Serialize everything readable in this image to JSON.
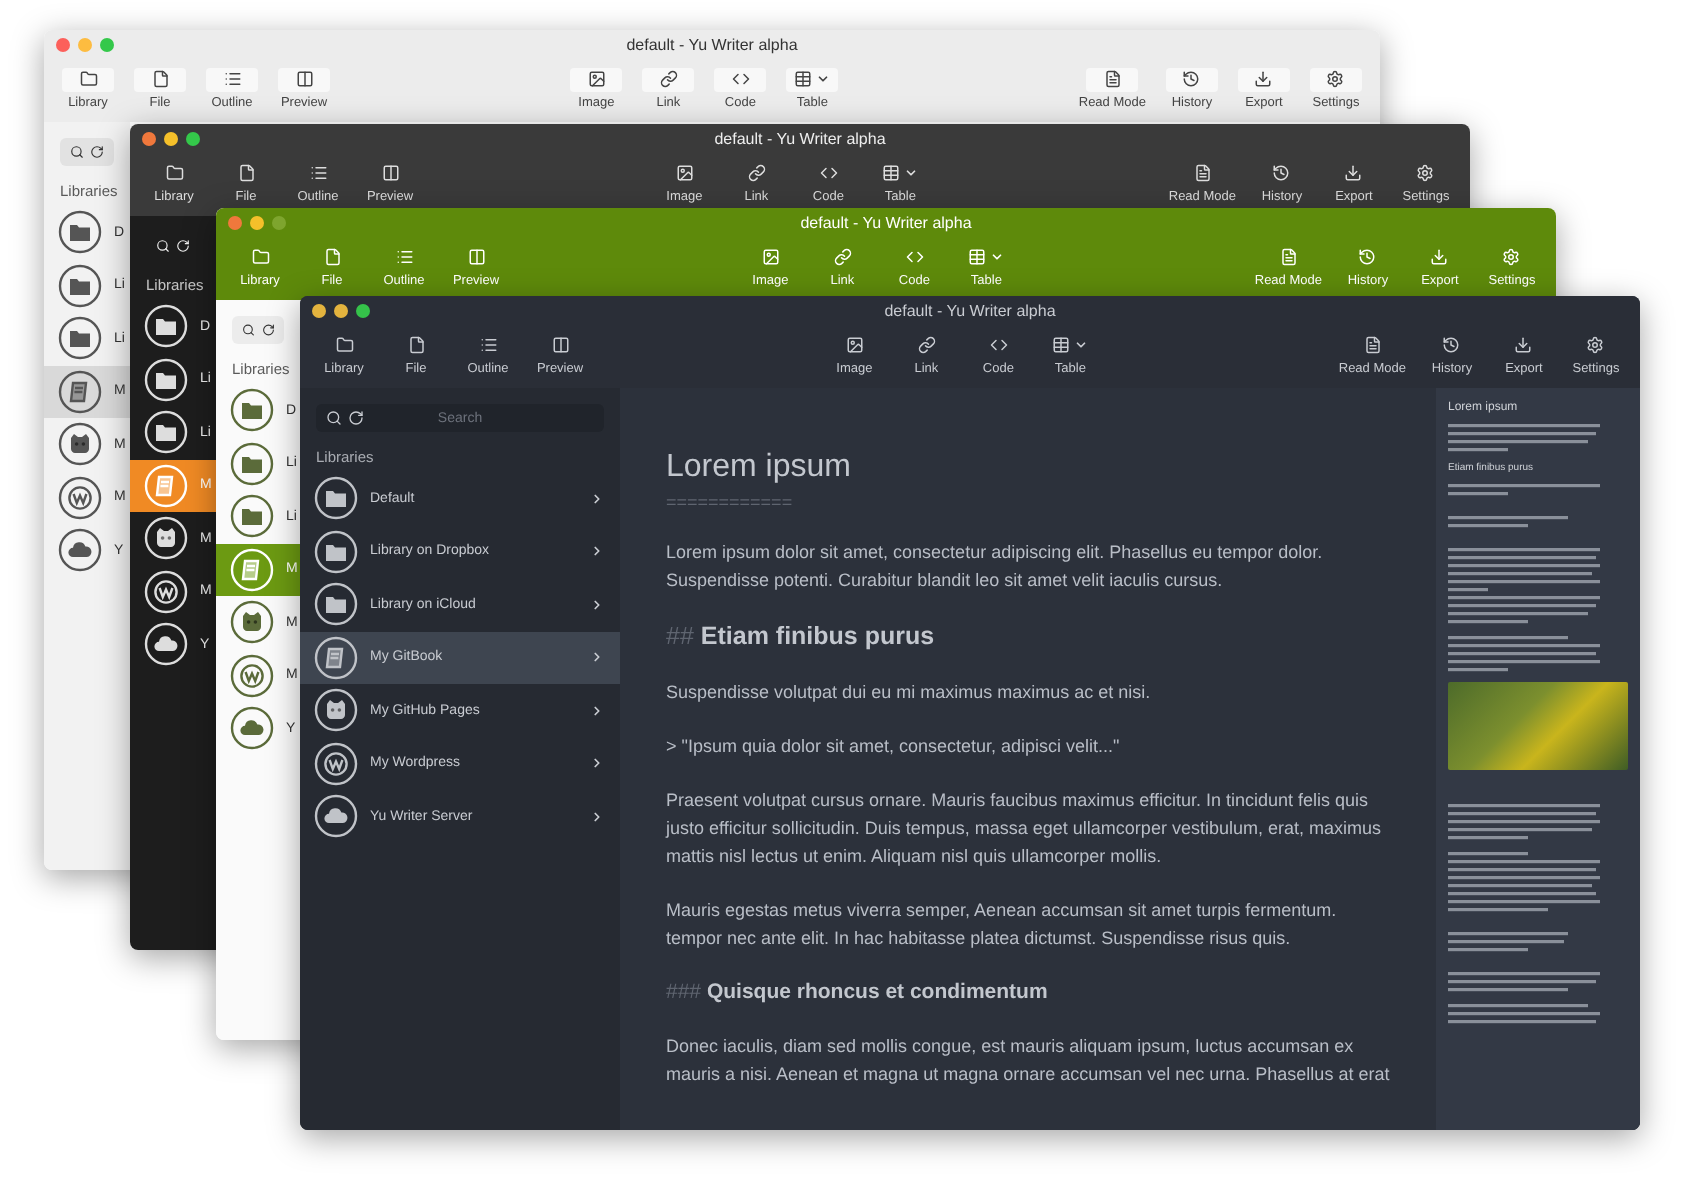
{
  "windows": [
    {
      "kind": "light",
      "title": "default - Yu Writer alpha",
      "toolbar": {
        "left": [
          {
            "label": "Library"
          },
          {
            "label": "File"
          },
          {
            "label": "Outline"
          },
          {
            "label": "Preview"
          }
        ],
        "center": [
          {
            "label": "Image"
          },
          {
            "label": "Link"
          },
          {
            "label": "Code"
          },
          {
            "label": "Table",
            "dropdown": true
          }
        ],
        "right": [
          {
            "label": "Read Mode"
          },
          {
            "label": "History"
          },
          {
            "label": "Export"
          },
          {
            "label": "Settings"
          }
        ]
      },
      "sidebar": {
        "heading": "Libraries",
        "items": [
          {
            "label": "D",
            "kind": "folder",
            "selected": false
          },
          {
            "label": "Li",
            "kind": "folder",
            "selected": false
          },
          {
            "label": "Li",
            "kind": "folder",
            "selected": false
          },
          {
            "label": "M",
            "kind": "book",
            "selected": true
          },
          {
            "label": "M",
            "kind": "cat",
            "selected": false
          },
          {
            "label": "M",
            "kind": "wordpress",
            "selected": false
          },
          {
            "label": "Y",
            "kind": "cloud",
            "selected": false
          }
        ]
      }
    },
    {
      "kind": "dark",
      "title": "default - Yu Writer alpha",
      "toolbar": {
        "left": [
          {
            "label": "Library"
          },
          {
            "label": "File"
          },
          {
            "label": "Outline"
          },
          {
            "label": "Preview"
          }
        ],
        "center": [
          {
            "label": "Image"
          },
          {
            "label": "Link"
          },
          {
            "label": "Code"
          },
          {
            "label": "Table",
            "dropdown": true
          }
        ],
        "right": [
          {
            "label": "Read Mode"
          },
          {
            "label": "History"
          },
          {
            "label": "Export"
          },
          {
            "label": "Settings"
          }
        ]
      },
      "sidebar": {
        "heading": "Libraries",
        "items": [
          {
            "label": "D",
            "kind": "folder",
            "selected": false
          },
          {
            "label": "Li",
            "kind": "folder",
            "selected": false
          },
          {
            "label": "Li",
            "kind": "folder",
            "selected": false
          },
          {
            "label": "M",
            "kind": "book",
            "selected": true
          },
          {
            "label": "M",
            "kind": "cat",
            "selected": false
          },
          {
            "label": "M",
            "kind": "wordpress",
            "selected": false
          },
          {
            "label": "Y",
            "kind": "cloud",
            "selected": false
          }
        ]
      }
    },
    {
      "kind": "green",
      "title": "default - Yu Writer alpha",
      "toolbar": {
        "left": [
          {
            "label": "Library"
          },
          {
            "label": "File"
          },
          {
            "label": "Outline"
          },
          {
            "label": "Preview"
          }
        ],
        "center": [
          {
            "label": "Image"
          },
          {
            "label": "Link"
          },
          {
            "label": "Code"
          },
          {
            "label": "Table",
            "dropdown": true
          }
        ],
        "right": [
          {
            "label": "Read Mode"
          },
          {
            "label": "History"
          },
          {
            "label": "Export"
          },
          {
            "label": "Settings"
          }
        ]
      },
      "sidebar": {
        "heading": "Libraries",
        "items": [
          {
            "label": "D",
            "kind": "folder",
            "selected": false
          },
          {
            "label": "Li",
            "kind": "folder",
            "selected": false
          },
          {
            "label": "Li",
            "kind": "folder",
            "selected": false
          },
          {
            "label": "M",
            "kind": "book",
            "selected": true
          },
          {
            "label": "M",
            "kind": "cat",
            "selected": false
          },
          {
            "label": "M",
            "kind": "wordpress",
            "selected": false
          },
          {
            "label": "Y",
            "kind": "cloud",
            "selected": false
          }
        ]
      }
    },
    {
      "kind": "navy",
      "title": "default - Yu Writer alpha",
      "toolbar": {
        "left": [
          {
            "label": "Library"
          },
          {
            "label": "File"
          },
          {
            "label": "Outline"
          },
          {
            "label": "Preview"
          }
        ],
        "center": [
          {
            "label": "Image"
          },
          {
            "label": "Link"
          },
          {
            "label": "Code"
          },
          {
            "label": "Table",
            "dropdown": true
          }
        ],
        "right": [
          {
            "label": "Read Mode"
          },
          {
            "label": "History"
          },
          {
            "label": "Export"
          },
          {
            "label": "Settings"
          }
        ]
      },
      "sidebar": {
        "search_placeholder": "Search",
        "heading": "Libraries",
        "items": [
          {
            "label": "Default",
            "kind": "folder",
            "selected": false
          },
          {
            "label": "Library on Dropbox",
            "kind": "folder",
            "selected": false
          },
          {
            "label": "Library on iCloud",
            "kind": "folder",
            "selected": false
          },
          {
            "label": "My GitBook",
            "kind": "book",
            "selected": true
          },
          {
            "label": "My GitHub Pages",
            "kind": "cat",
            "selected": false
          },
          {
            "label": "My Wordpress",
            "kind": "wordpress",
            "selected": false
          },
          {
            "label": "Yu Writer Server",
            "kind": "cloud",
            "selected": false
          }
        ]
      },
      "editor": {
        "blocks": [
          {
            "kind": "h1",
            "text": "Lorem ipsum",
            "underline": "============"
          },
          {
            "kind": "p",
            "text": "Lorem ipsum dolor sit amet, consectetur adipiscing elit. Phasellus eu tempor dolor. Suspendisse potenti. Curabitur blandit leo sit amet velit iaculis cursus."
          },
          {
            "kind": "h2",
            "marker": "##",
            "text": "Etiam finibus purus"
          },
          {
            "kind": "p",
            "text": "Suspendisse volutpat dui eu mi maximus maximus ac et nisi."
          },
          {
            "kind": "quote",
            "text": "> \"Ipsum quia dolor sit amet, consectetur, adipisci velit...\""
          },
          {
            "kind": "p",
            "text": "Praesent volutpat cursus ornare. Mauris faucibus maximus efficitur. In tincidunt felis quis justo efficitur sollicitudin. Duis tempus, massa eget ullamcorper vestibulum, erat, maximus mattis nisl lectus ut enim. Aliquam nisl quis ullamcorper mollis."
          },
          {
            "kind": "p",
            "text": "Mauris egestas metus viverra semper, Aenean accumsan sit amet turpis fermentum. tempor nec ante elit. In hac habitasse platea dictumst. Suspendisse risus quis."
          },
          {
            "kind": "h3",
            "marker": "###",
            "text": "Quisque rhoncus et condimentum"
          },
          {
            "kind": "p",
            "text": "Donec iaculis, diam sed mollis congue, est mauris aliquam ipsum, luctus accumsan ex mauris a nisi. Aenean et magna ut magna ornare accumsan vel nec urna. Phasellus at erat"
          }
        ]
      },
      "preview": {
        "title": "Lorem ipsum",
        "heading": "Etiam finibus purus"
      }
    }
  ]
}
